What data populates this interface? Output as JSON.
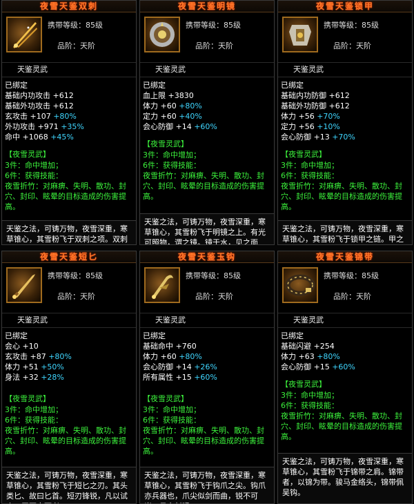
{
  "cards": [
    {
      "title": "夜雪天鉴双刺",
      "level": "携带等级：85级",
      "grade": "品阶：天阶",
      "sub": "天鉴灵武",
      "bound": "已绑定",
      "stats": [
        {
          "n": "基础内功攻击",
          "v": "+612",
          "b": ""
        },
        {
          "n": "基础外功攻击",
          "v": "+612",
          "b": ""
        },
        {
          "n": "玄攻击",
          "v": "+107",
          "b": "+80%"
        },
        {
          "n": "外功攻击",
          "v": "+971",
          "b": "+35%"
        },
        {
          "n": "命中",
          "v": "+1068",
          "b": "+45%"
        }
      ],
      "set_title": "【夜雪灵武】",
      "set3": "3件：命中增加；",
      "set6": "6件：获得技能：",
      "skill": "夜雪折竹：对麻痹、失明、散功、封穴、封印、眩晕的目标造成的伤害提高。",
      "lore": "天鉴之法，可铸万物，夜雪深重，寒草锥心，其雪粉飞于双刺之项。双刺呈菱形，尖锋锐利，含寒芒，刺之透"
    },
    {
      "title": "夜雪天鉴明镜",
      "level": "携带等级：85级",
      "grade": "品阶：天阶",
      "sub": "天鉴灵武",
      "bound": "已绑定",
      "stats": [
        {
          "n": "血上限",
          "v": "+3830",
          "b": ""
        },
        {
          "n": "体力",
          "v": "+60",
          "b": "+80%"
        },
        {
          "n": "定力",
          "v": "+60",
          "b": "+40%"
        },
        {
          "n": "会心防御",
          "v": "+14",
          "b": "+60%"
        }
      ],
      "set_title": "【夜雪灵武】",
      "set3": "3件：命中增加；",
      "set6": "6件：获得技能：",
      "skill": "夜雪折竹：对麻痹、失明、散功、封穴、封印、眩晕的目标造成的伤害提高。",
      "lore": "天鉴之法，可铸万物，夜雪深重，寒草锥心，其雪粉飞于明镜之上。有光可照物，谓之镜。镜于水，见之面容；镜于人，则知吉凶"
    },
    {
      "title": "夜雪天鉴锁甲",
      "level": "携带等级：85级",
      "grade": "品阶：天阶",
      "sub": "天鉴灵武",
      "bound": "已绑定",
      "stats": [
        {
          "n": "基础内功防御",
          "v": "+612",
          "b": ""
        },
        {
          "n": "基础外功防御",
          "v": "+612",
          "b": ""
        },
        {
          "n": "体力",
          "v": "+56",
          "b": "+70%"
        },
        {
          "n": "定力",
          "v": "+56",
          "b": "+10%"
        },
        {
          "n": "会心防御",
          "v": "+13",
          "b": "+70%"
        }
      ],
      "set_title": "【夜雪灵武】",
      "set3": "3件：命中增加；",
      "set6": "6件：获得技能：",
      "skill": "夜雪折竹：对麻痹、失明、散功、封穴、封印、眩晕的目标造成的伤害提高。",
      "lore": "天鉴之法，可铸万物，夜雪深重，寒草锥心，其雪粉飞于锁甲之链。甲之精细者为锁子甲，真其相衔之密也，故如环"
    },
    {
      "title": "夜雪天鉴短匕",
      "level": "携带等级：85级",
      "grade": "品阶：天阶",
      "sub": "天鉴灵武",
      "bound": "已绑定",
      "stats": [
        {
          "n": "会心",
          "v": "+10",
          "b": ""
        },
        {
          "n": "玄攻击",
          "v": "+87",
          "b": "+80%"
        },
        {
          "n": "体力",
          "v": "+51",
          "b": "+50%"
        },
        {
          "n": "身法",
          "v": "+32",
          "b": "+28%"
        }
      ],
      "set_title": "【夜雪灵武】",
      "set3": "3件：命中增加；",
      "set6": "6件：获得技能：",
      "skill": "夜雪折竹：对麻痹、失明、散功、封穴、封印、眩晕的目标造成的伤害提高。",
      "lore": "天鉴之法，可铸万物，夜雪深重，寒草锥心，其雪粉飞于短匕之刃。其头类匕、故曰匕首。短刃锋锐，凡以试人，无不立死者"
    },
    {
      "title": "夜雪天鉴玉钩",
      "level": "携带等级：85级",
      "grade": "品阶：天阶",
      "sub": "天鉴灵武",
      "bound": "已绑定",
      "stats": [
        {
          "n": "基础命中",
          "v": "+760",
          "b": ""
        },
        {
          "n": "体力",
          "v": "+60",
          "b": "+80%"
        },
        {
          "n": "会心防御",
          "v": "+14",
          "b": "+26%"
        },
        {
          "n": "所有属性",
          "v": "+15",
          "b": "+60%"
        }
      ],
      "set_title": "【夜雪灵武】",
      "set3": "3件：命中增加；",
      "set6": "6件：获得技能：",
      "skill": "夜雪折竹：对麻痹、失明、散功、封穴、封印、眩晕的目标造成的伤害提高。",
      "lore": "天鉴之法，可铸万物，夜雪深重，寒草锥心，其雪粉飞于钩爪之尖。钩爪亦兵器也，爪尖似剑而曲，锐不可当，见血封喉"
    },
    {
      "title": "夜雪天鉴锦带",
      "level": "携带等级：85级",
      "grade": "品阶：天阶",
      "sub": "天鉴灵武",
      "bound": "已绑定",
      "stats": [
        {
          "n": "基础闪避",
          "v": "+254",
          "b": ""
        },
        {
          "n": "体力",
          "v": "+63",
          "b": "+80%"
        },
        {
          "n": "会心防御",
          "v": "+15",
          "b": "+60%"
        }
      ],
      "set_title": "【夜雪灵武】",
      "set3": "3件：命中增加；",
      "set6": "6件：获得技能：",
      "skill": "夜雪折竹：对麻痹、失明、散功、封穴、封印、眩晕的目标造成的伤害提高。",
      "lore": "天鉴之法，可铸万物，夜雪深重，寒草锥心，其雪粉飞于锦带之肩。锦带者，以锦为带。骏马金络头，锦带佩吴钩。"
    }
  ],
  "icons": [
    "twin-daggers-icon",
    "mirror-icon",
    "chain-armor-icon",
    "dagger-icon",
    "hook-claw-icon",
    "belt-icon"
  ]
}
